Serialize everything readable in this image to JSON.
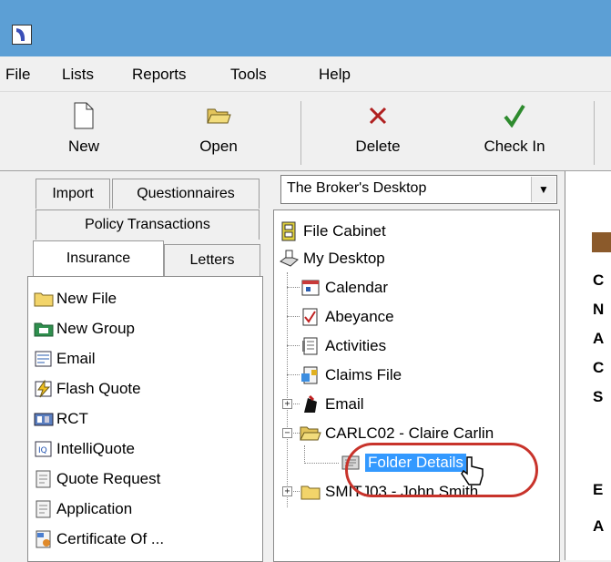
{
  "menu": [
    "File",
    "Lists",
    "Reports",
    "Tools",
    "Help"
  ],
  "toolbar": {
    "new_label": "New",
    "open_label": "Open",
    "delete_label": "Delete",
    "checkin_label": "Check In"
  },
  "tabs": {
    "import": "Import",
    "questionnaires": "Questionnaires",
    "policy_transactions": "Policy Transactions",
    "insurance": "Insurance",
    "letters": "Letters"
  },
  "insurance_list": [
    {
      "label": "New File",
      "icon": "folder-icon"
    },
    {
      "label": "New Group",
      "icon": "group-folder-icon"
    },
    {
      "label": "Email",
      "icon": "email-doc-icon"
    },
    {
      "label": "Flash Quote",
      "icon": "flash-icon"
    },
    {
      "label": "RCT",
      "icon": "rct-icon"
    },
    {
      "label": "IntelliQuote",
      "icon": "iq-icon"
    },
    {
      "label": "Quote Request",
      "icon": "doc-icon"
    },
    {
      "label": "Application",
      "icon": "doc-icon"
    },
    {
      "label": "Certificate Of ...",
      "icon": "certificate-icon"
    }
  ],
  "desktop_combo": {
    "value": "The Broker's Desktop"
  },
  "tree": {
    "file_cabinet": "File Cabinet",
    "my_desktop": "My Desktop",
    "calendar": "Calendar",
    "abeyance": "Abeyance",
    "activities": "Activities",
    "claims_file": "Claims File",
    "email": "Email",
    "carlc02": "CARLC02 - Claire Carlin",
    "folder_details": "Folder Details",
    "smitj03": "SMITJ03 - John Smith ..."
  },
  "right_letters": [
    "C",
    "N",
    "A",
    "C",
    "S",
    "E",
    "A"
  ],
  "colors": {
    "titlebar": "#5c9fd5",
    "selection": "#3399ff",
    "highlight_ring": "#c8332b"
  }
}
